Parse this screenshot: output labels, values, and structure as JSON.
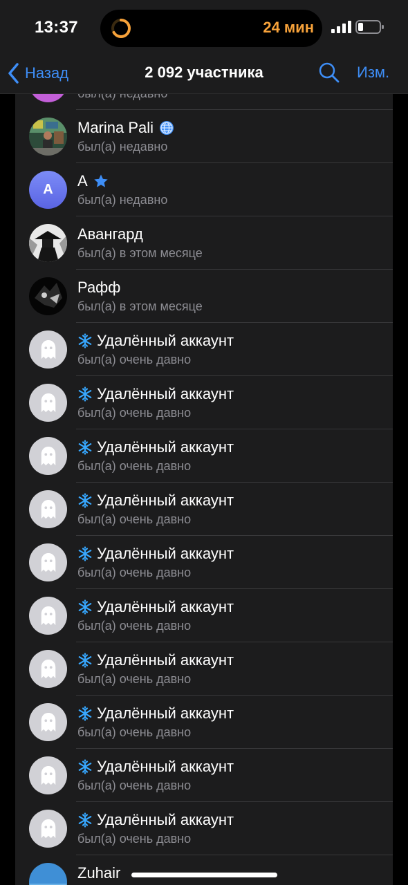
{
  "status_bar": {
    "time": "13:37",
    "island_text": "24 мин",
    "accent_color": "#f7a23a"
  },
  "navbar": {
    "back_label": "Назад",
    "title": "2 092 участника",
    "edit_label": "Изм.",
    "accent_color": "#3e8ef7"
  },
  "members": [
    {
      "name": "",
      "status": "был(а) недавно",
      "avatar": "pink"
    },
    {
      "name": "Marina Pali",
      "status": "был(а) недавно",
      "avatar": "photo-street",
      "badge": "globe-icon"
    },
    {
      "name": "А",
      "status": "был(а) недавно",
      "avatar": "letter",
      "initial": "А",
      "badge": "star-icon"
    },
    {
      "name": "Авангард",
      "status": "был(а) в этом месяце",
      "avatar": "photo-samurai"
    },
    {
      "name": "Рафф",
      "status": "был(а) в этом месяце",
      "avatar": "photo-dark"
    },
    {
      "name": "Удалённый аккаунт",
      "status": "был(а) очень давно",
      "avatar": "ghost",
      "pre_badge": "snowflake-icon"
    },
    {
      "name": "Удалённый аккаунт",
      "status": "был(а) очень давно",
      "avatar": "ghost",
      "pre_badge": "snowflake-icon"
    },
    {
      "name": "Удалённый аккаунт",
      "status": "был(а) очень давно",
      "avatar": "ghost",
      "pre_badge": "snowflake-icon"
    },
    {
      "name": "Удалённый аккаунт",
      "status": "был(а) очень давно",
      "avatar": "ghost",
      "pre_badge": "snowflake-icon"
    },
    {
      "name": "Удалённый аккаунт",
      "status": "был(а) очень давно",
      "avatar": "ghost",
      "pre_badge": "snowflake-icon"
    },
    {
      "name": "Удалённый аккаунт",
      "status": "был(а) очень давно",
      "avatar": "ghost",
      "pre_badge": "snowflake-icon"
    },
    {
      "name": "Удалённый аккаунт",
      "status": "был(а) очень давно",
      "avatar": "ghost",
      "pre_badge": "snowflake-icon"
    },
    {
      "name": "Удалённый аккаунт",
      "status": "был(а) очень давно",
      "avatar": "ghost",
      "pre_badge": "snowflake-icon"
    },
    {
      "name": "Удалённый аккаунт",
      "status": "был(а) очень давно",
      "avatar": "ghost",
      "pre_badge": "snowflake-icon"
    },
    {
      "name": "Удалённый аккаунт",
      "status": "был(а) очень давно",
      "avatar": "ghost",
      "pre_badge": "snowflake-icon"
    },
    {
      "name": "Zuhair",
      "status": "",
      "avatar": "photo-sky"
    }
  ]
}
